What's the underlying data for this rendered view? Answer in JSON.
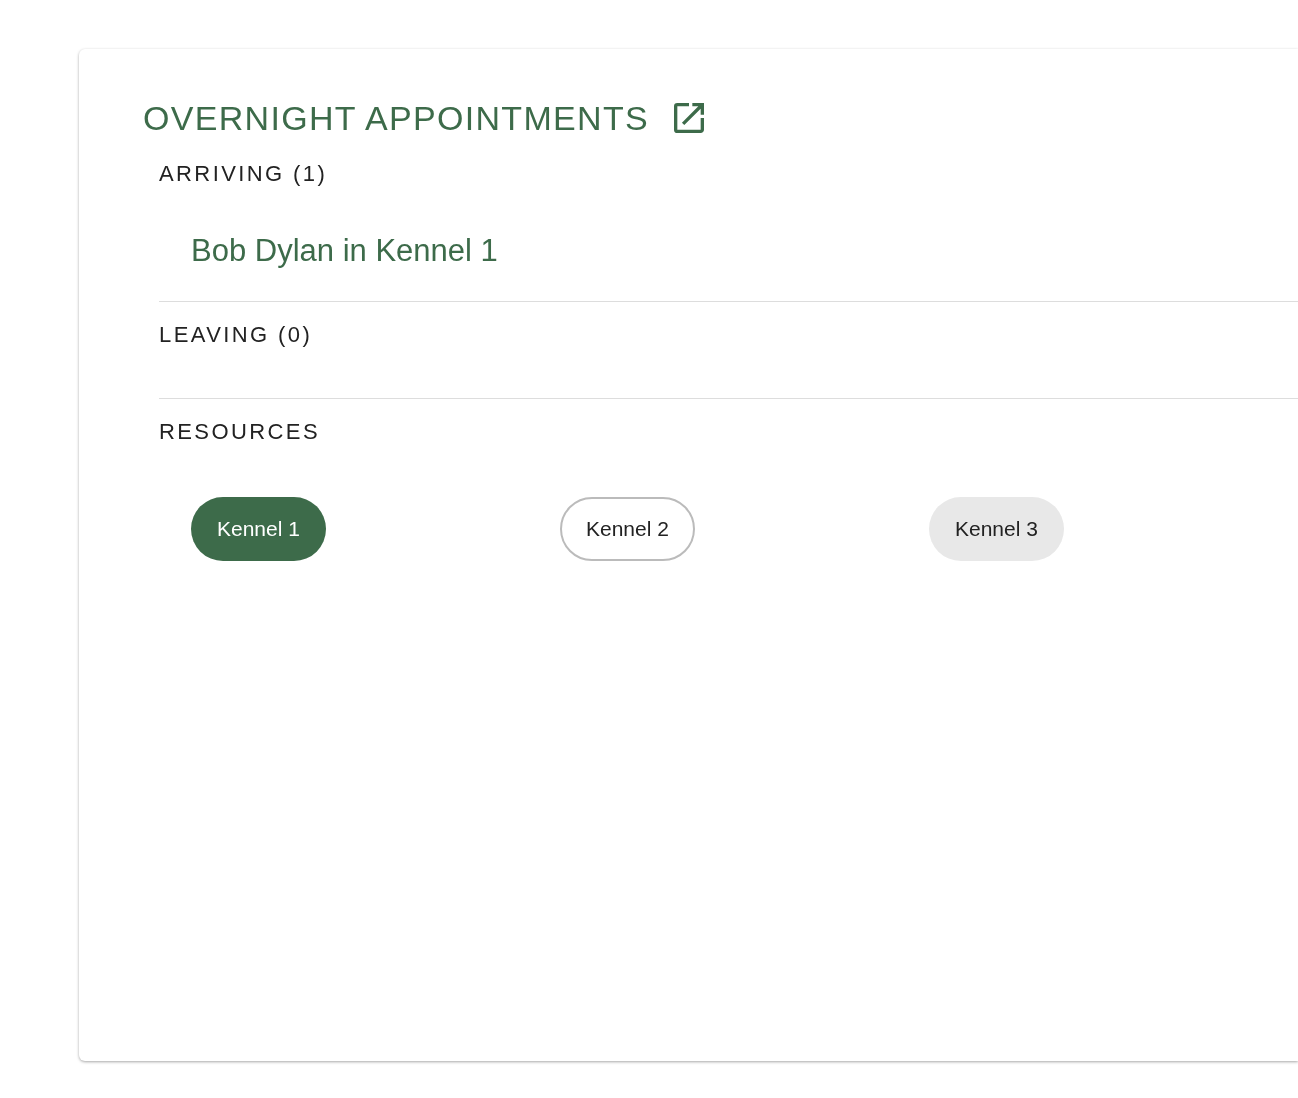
{
  "card": {
    "title": "OVERNIGHT APPOINTMENTS",
    "sections": [
      {
        "heading": "ARRIVING (1)",
        "items": [
          "Bob Dylan in Kennel 1"
        ]
      },
      {
        "heading": "LEAVING (0)"
      },
      {
        "heading": "RESOURCES",
        "chips": [
          {
            "label": "Kennel 1",
            "kind": "filled"
          },
          {
            "label": "Kennel 2",
            "kind": "outlined"
          },
          {
            "label": "Kennel 3",
            "kind": "tonal"
          }
        ]
      }
    ]
  }
}
